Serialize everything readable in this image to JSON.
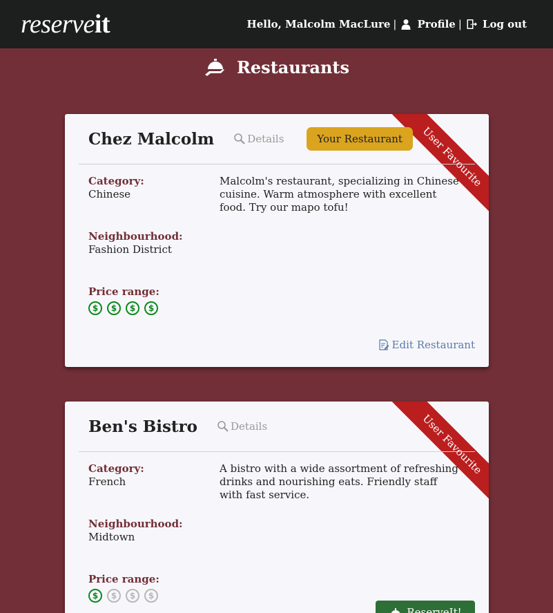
{
  "navbar": {
    "brand_part1": "reserve",
    "brand_part2": "it",
    "greeting": "Hello, Malcolm MacLure",
    "profile_label": "Profile",
    "logout_label": "Log out",
    "separator": "|"
  },
  "page": {
    "title": "Restaurants",
    "title_icon": "bell-serving-icon"
  },
  "restaurants": [
    {
      "name": "Chez Malcolm",
      "details_label": "Details",
      "badge": "Your Restaurant",
      "ribbon": "User Favourite",
      "category_label": "Category:",
      "category": "Chinese",
      "neighbourhood_label": "Neighbourhood:",
      "neighbourhood": "Fashion District",
      "price_label": "Price range:",
      "price_level": 4,
      "price_max": 4,
      "description": "Malcolm's restaurant, specializing in Chinese cuisine. Warm atmosphere with excellent food. Try our mapo tofu!",
      "action_label": "Edit Restaurant"
    },
    {
      "name": "Ben's Bistro",
      "details_label": "Details",
      "ribbon": "User Favourite",
      "category_label": "Category:",
      "category": "French",
      "neighbourhood_label": "Neighbourhood:",
      "neighbourhood": "Midtown",
      "price_label": "Price range:",
      "price_level": 1,
      "price_max": 4,
      "description": "A bistro with a wide assortment of refreshing drinks and nourishing eats. Friendly staff with fast service.",
      "action_label": "ReserveIt!"
    }
  ],
  "colors": {
    "background": "#722f37",
    "navbar": "#1c1f1e",
    "ribbon": "#bb1e1e",
    "badge": "#dba41e",
    "reserve_button": "#2e6f37",
    "price_active": "#0a8a1e",
    "label": "#722f37",
    "link": "#5a7aa8"
  }
}
